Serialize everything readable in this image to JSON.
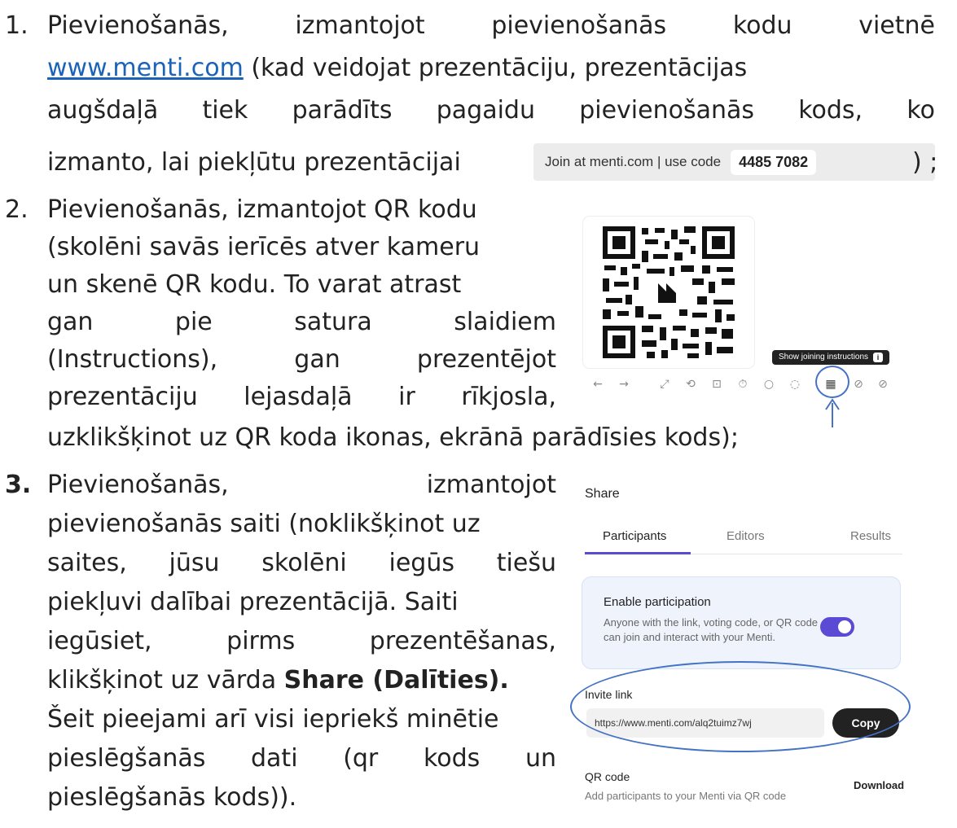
{
  "item1": {
    "number": "1.",
    "line1_words": [
      "Pievienošanās,",
      "izmantojot",
      "pievienošanās",
      "kodu",
      "vietnē"
    ],
    "link": "www.menti.com",
    "line2_rest": " (kad veidojat prezentāciju, prezentācijas",
    "line3_words": [
      "augšdaļā",
      "tiek",
      "parādīts",
      "pagaidu",
      "pievienošanās",
      "kods,",
      "ko"
    ],
    "line4": "izmanto, lai piekļūtu prezentācijai",
    "line4_end": ") ;"
  },
  "join_banner": {
    "text": "Join at menti.com | use code",
    "code": "4485 7082"
  },
  "item2": {
    "number": "2.",
    "line1": "Pievienošanās, izmantojot QR kodu",
    "line2": "(skolēni savās ierīcēs atver kameru",
    "line3": "un skenē QR kodu. To varat atrast",
    "line4_words": [
      "gan",
      "pie",
      "satura",
      "slaidiem"
    ],
    "line5_words": [
      "(Instructions),",
      "gan",
      "prezentējot"
    ],
    "line6_words": [
      "prezentāciju",
      "lejasdaļā",
      "ir",
      "rīkjosla,"
    ],
    "line7": "uzklikšķinot uz QR koda ikonas, ekrānā parādīsies kods);"
  },
  "toolbar": {
    "tooltip": "Show joining instructions",
    "tooltip_icon": "i",
    "icons": [
      "←",
      "→",
      "⤢",
      "⟲",
      "⊡",
      "⏱",
      "○",
      "◌",
      "▦",
      "⊘",
      "⊘"
    ]
  },
  "item3": {
    "number": "3.",
    "line1_words": [
      "Pievienošanās,",
      "izmantojot"
    ],
    "line2": "pievienošanās saiti (noklikšķinot uz",
    "line3_words": [
      "saites,",
      "jūsu",
      "skolēni",
      "iegūs",
      "tiešu"
    ],
    "line4": "piekļuvi dalībai prezentācijā. Saiti",
    "line5_words": [
      "iegūsiet,",
      "pirms",
      "prezentēšanas,"
    ],
    "line6_pre": "klikšķinot uz vārda ",
    "line6_bold": "Share (Dalīties).",
    "line7": "Šeit pieejami arī visi iepriekš minētie",
    "line8_words": [
      "pieslēgšanās",
      "dati",
      "(qr",
      "kods",
      "un"
    ],
    "line9": "pieslēgšanās kods))."
  },
  "share": {
    "title": "Share",
    "tabs": [
      "Participants",
      "Editors",
      "Results"
    ],
    "enable_title": "Enable participation",
    "enable_desc": "Anyone with the link, voting code, or QR code can join and interact with your Menti.",
    "invite_label": "Invite link",
    "invite_url": "https://www.menti.com/alq2tuimz7wj",
    "copy": "Copy",
    "qr_label": "QR code",
    "qr_desc": "Add participants to your Menti via QR code",
    "download": "Download"
  },
  "colors": {
    "link": "#1a63b8",
    "accent": "#5b4ad3",
    "annotation": "#4472c4"
  }
}
